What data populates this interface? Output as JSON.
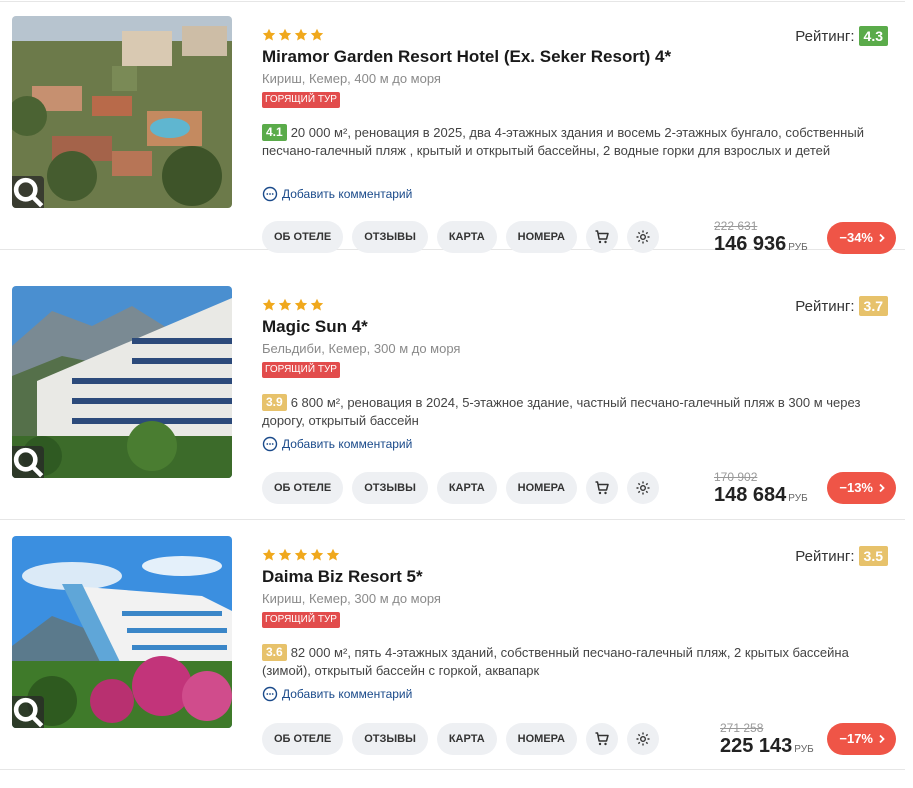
{
  "hotels": [
    {
      "stars": 4,
      "name": "Miramor Garden Resort Hotel (Ex. Seker Resort) 4*",
      "location": "Кириш, Кемер, 400 м до моря",
      "hot_label": "ГОРЯЩИЙ ТУР",
      "score": "4.1",
      "score_color": "#5aab4a",
      "description": "20 000 м², реновация в 2025, два 4-этажных здания и восемь 2-этажных бунгало, собственный песчано-галечный пляж , крытый и открытый бассейны, 2 водные горки для взрослых и детей",
      "comment_link": "Добавить комментарий",
      "rating_label": "Рейтинг:",
      "rating_value": "4.3",
      "rating_color": "#5aab4a",
      "buttons": [
        "ОБ ОТЕЛЕ",
        "ОТЗЫВЫ",
        "КАРТА",
        "НОМЕРА"
      ],
      "old_price": "222 631",
      "new_price": "146 936",
      "currency": "РУБ",
      "discount": "−34%"
    },
    {
      "stars": 4,
      "name": "Magic Sun 4*",
      "location": "Бельдиби, Кемер, 300 м до моря",
      "hot_label": "ГОРЯЩИЙ ТУР",
      "score": "3.9",
      "score_color": "#e7c26b",
      "description": "6 800 м², реновация в 2024, 5-этажное здание, частный песчано-галечный пляж в 300 м через дорогу, открытый бассейн",
      "comment_link": "Добавить комментарий",
      "rating_label": "Рейтинг:",
      "rating_value": "3.7",
      "rating_color": "#e7c26b",
      "buttons": [
        "ОБ ОТЕЛЕ",
        "ОТЗЫВЫ",
        "КАРТА",
        "НОМЕРА"
      ],
      "old_price": "170 902",
      "new_price": "148 684",
      "currency": "РУБ",
      "discount": "−13%"
    },
    {
      "stars": 5,
      "name": "Daima Biz Resort 5*",
      "location": "Кириш, Кемер, 300 м до моря",
      "hot_label": "ГОРЯЩИЙ ТУР",
      "score": "3.6",
      "score_color": "#e7c26b",
      "description": "82 000 м², пять 4-этажных зданий, собственный песчано-галечный пляж, 2 крытых бассейна (зимой), открытый бассейн с горкой, аквапарк",
      "comment_link": "Добавить комментарий",
      "rating_label": "Рейтинг:",
      "rating_value": "3.5",
      "rating_color": "#e7c26b",
      "buttons": [
        "ОБ ОТЕЛЕ",
        "ОТЗЫВЫ",
        "КАРТА",
        "НОМЕРА"
      ],
      "old_price": "271 258",
      "new_price": "225 143",
      "currency": "РУБ",
      "discount": "−17%"
    }
  ],
  "icons": {
    "cart": "cart-icon",
    "settings": "gear-icon",
    "zoom": "search-icon",
    "comment": "comment-icon",
    "chevron": "chevron-right-icon",
    "star": "star-icon"
  },
  "colors": {
    "hot_badge": "#e24c4c",
    "discount": "#ef5547",
    "star": "#f0a81c",
    "link": "#1a4a8a"
  }
}
